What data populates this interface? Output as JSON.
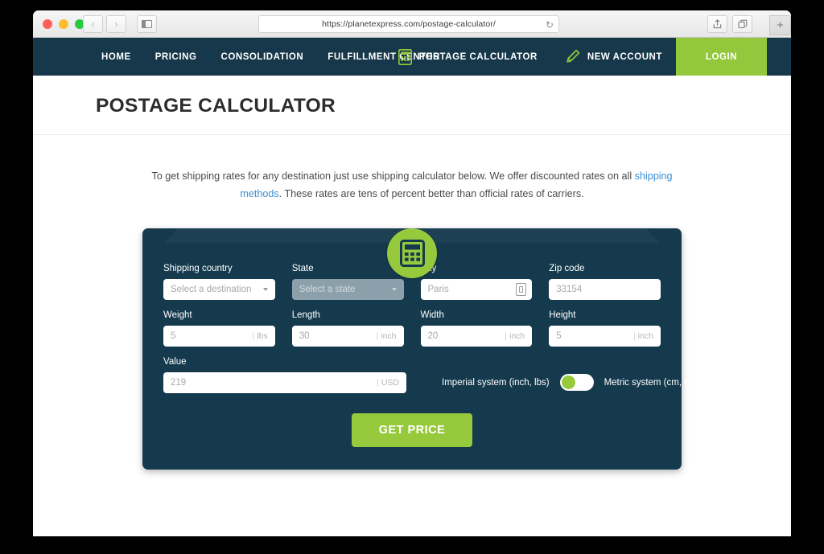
{
  "browser": {
    "url": "https://planetexpress.com/postage-calculator/",
    "reload_icon": "reload-icon",
    "back_icon": "‹",
    "forward_icon": "›",
    "share_icon": "share-icon",
    "tabs_icon": "tabs-icon",
    "newtab_label": "+"
  },
  "nav": {
    "links": [
      {
        "label": "HOME"
      },
      {
        "label": "PRICING"
      },
      {
        "label": "CONSOLIDATION"
      },
      {
        "label": "FULFILLMENT CENTER"
      }
    ],
    "postage_calculator": "POSTAGE CALCULATOR",
    "new_account": "NEW ACCOUNT",
    "login": "LOGIN",
    "accent_green": "#93c83d",
    "navy": "#16384a"
  },
  "page": {
    "title": "POSTAGE CALCULATOR",
    "intro_part1": "To get shipping rates for any destination just use shipping calculator below. We offer discounted rates on all ",
    "intro_link": "shipping methods",
    "intro_part2": ". These rates are tens of percent better than official rates of carriers."
  },
  "form": {
    "shipping_country": {
      "label": "Shipping country",
      "value": "Select a destination"
    },
    "state": {
      "label": "State",
      "value": "Select a state"
    },
    "city": {
      "label": "City",
      "placeholder": "Paris"
    },
    "zip": {
      "label": "Zip code",
      "placeholder": "33154"
    },
    "weight": {
      "label": "Weight",
      "placeholder": "5",
      "unit": "lbs"
    },
    "length": {
      "label": "Length",
      "placeholder": "30",
      "unit": "inch"
    },
    "width": {
      "label": "Width",
      "placeholder": "20",
      "unit": "inch"
    },
    "height": {
      "label": "Height",
      "placeholder": "5",
      "unit": "inch"
    },
    "value": {
      "label": "Value",
      "placeholder": "219",
      "unit": "USD"
    },
    "imperial_label": "Imperial system (inch, lbs)",
    "metric_label": "Metric system (cm, kg)",
    "toggle_state": "imperial",
    "submit_label": "GET PRICE",
    "card_bg": "#153a4e"
  }
}
